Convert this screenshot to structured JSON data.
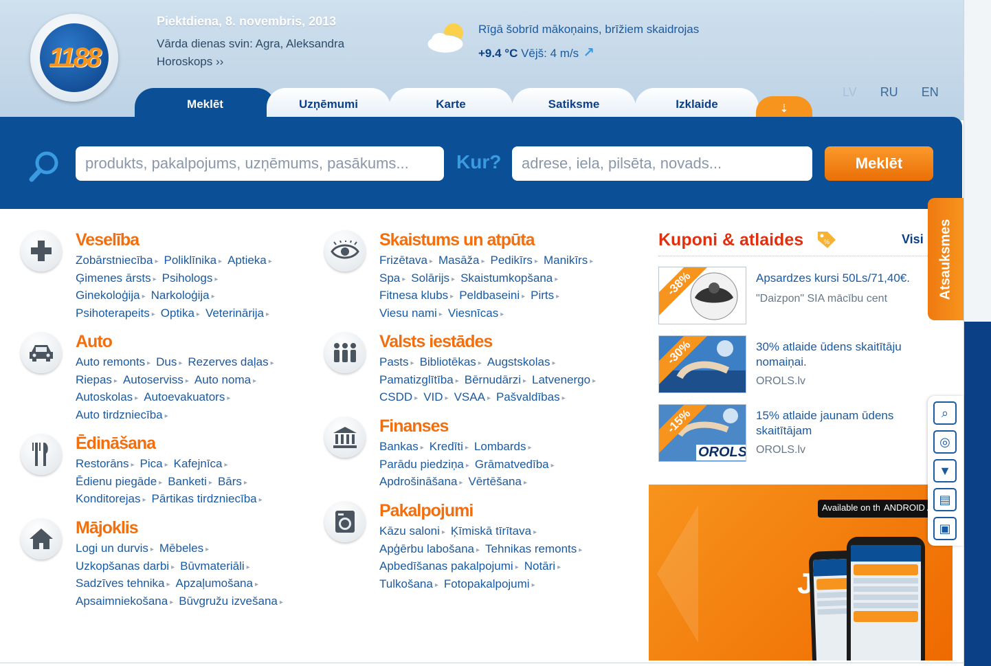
{
  "header": {
    "logo_text": "1188",
    "date": "Piektdiena, 8. novembris, 2013",
    "namedays": "Vārda dienas svin: Agra, Aleksandra",
    "horoscope": "Horoskops ››",
    "weather": {
      "text": "Rīgā šobrīd mākoņains, brīžiem skaidrojas",
      "temp": "+9.4 °C",
      "wind": "Vējš: 4 m/s"
    }
  },
  "tabs": [
    {
      "label": "Meklēt",
      "active": true
    },
    {
      "label": "Uzņēmumi"
    },
    {
      "label": "Karte"
    },
    {
      "label": "Satiksme"
    },
    {
      "label": "Izklaide"
    }
  ],
  "languages": [
    "LV",
    "RU",
    "EN"
  ],
  "search": {
    "what_placeholder": "produkts, pakalpojums, uzņēmums, pasākums...",
    "where_label": "Kur?",
    "where_placeholder": "adrese, iela, pilsēta, novads...",
    "button": "Meklēt"
  },
  "categories": {
    "health": {
      "title": "Veselība",
      "icon": "medical-cross-icon",
      "rows": [
        [
          "Zobārstniecība",
          "Poliklīnika",
          "Aptieka"
        ],
        [
          "Ģimenes ārsts",
          "Psihologs"
        ],
        [
          "Ginekoloģija",
          "Narkoloģija"
        ],
        [
          "Psihoterapeits",
          "Optika",
          "Veterinārija"
        ]
      ]
    },
    "auto": {
      "title": "Auto",
      "icon": "car-icon",
      "rows": [
        [
          "Auto remonts",
          "Dus",
          "Rezerves daļas"
        ],
        [
          "Riepas",
          "Autoserviss",
          "Auto noma"
        ],
        [
          "Autoskolas",
          "Autoevakuators"
        ],
        [
          "Auto tirdzniecība"
        ]
      ]
    },
    "food": {
      "title": "Ēdināšana",
      "icon": "fork-knife-icon",
      "rows": [
        [
          "Restorāns",
          "Pica",
          "Kafejnīca"
        ],
        [
          "Ēdienu piegāde",
          "Banketi",
          "Bārs"
        ],
        [
          "Konditorejas",
          "Pārtikas tirdzniecība"
        ]
      ]
    },
    "home": {
      "title": "Mājoklis",
      "icon": "house-icon",
      "rows": [
        [
          "Logi un durvis",
          "Mēbeles"
        ],
        [
          "Uzkopšanas darbi",
          "Būvmateriāli"
        ],
        [
          "Sadzīves tehnika",
          "Apzaļumošana"
        ],
        [
          "Apsaimniekošana",
          "Būvgružu izvešana"
        ]
      ]
    },
    "beauty": {
      "title": "Skaistums un atpūta",
      "icon": "eye-icon",
      "rows": [
        [
          "Frizētava",
          "Masāža",
          "Pedikīrs",
          "Manikīrs"
        ],
        [
          "Spa",
          "Solārijs",
          "Skaistumkopšana"
        ],
        [
          "Fitnesa klubs",
          "Peldbaseini",
          "Pirts"
        ],
        [
          "Viesu nami",
          "Viesnīcas"
        ]
      ]
    },
    "state": {
      "title": "Valsts iestādes",
      "icon": "people-icon",
      "rows": [
        [
          "Pasts",
          "Bibliotēkas",
          "Augstskolas"
        ],
        [
          "Pamatizglītība",
          "Bērnudārzi",
          "Latvenergo"
        ],
        [
          "CSDD",
          "VID",
          "VSAA",
          "Pašvaldības"
        ]
      ]
    },
    "finance": {
      "title": "Finanses",
      "icon": "bank-icon",
      "rows": [
        [
          "Bankas",
          "Kredīti",
          "Lombards"
        ],
        [
          "Parādu piedziņa",
          "Grāmatvedība"
        ],
        [
          "Apdrošināšana",
          "Vērtēšana"
        ]
      ]
    },
    "services": {
      "title": "Pakalpojumi",
      "icon": "washing-machine-icon",
      "rows": [
        [
          "Kāzu saloni",
          "Ķīmiskā tīrītava"
        ],
        [
          "Apģērbu labošana",
          "Tehnikas remonts"
        ],
        [
          "Apbedīšanas pakalpojumi",
          "Notāri"
        ],
        [
          "Tulkošana",
          "Fotopakalpojumi"
        ]
      ]
    }
  },
  "coupons": {
    "title": "Kuponi & atlaides",
    "all_label": "Visi",
    "items": [
      {
        "discount": "-38%",
        "text": "Apsardzes kursi 50Ls/71,40€.",
        "source": "\"Daizpon\" SIA mācību cent"
      },
      {
        "discount": "-30%",
        "text": "30% atlaide ūdens skaitītāju nomaiņai.",
        "source": "OROLS.lv"
      },
      {
        "discount": "-15%",
        "text": "15% atlaide jaunam ūdens skaitītājam",
        "source": "OROLS.lv",
        "thumb_label": "OROLS"
      }
    ]
  },
  "feedback": "Atsauksmes",
  "banner": {
    "appstore": "Available on the App Store",
    "google": "ANDROID APP ON Google play",
    "text": "JA"
  },
  "colors": {
    "brand_blue": "#0b4f97",
    "accent_orange": "#f7941d",
    "category_title": "#f26f0f",
    "coupon_title": "#e03010"
  }
}
